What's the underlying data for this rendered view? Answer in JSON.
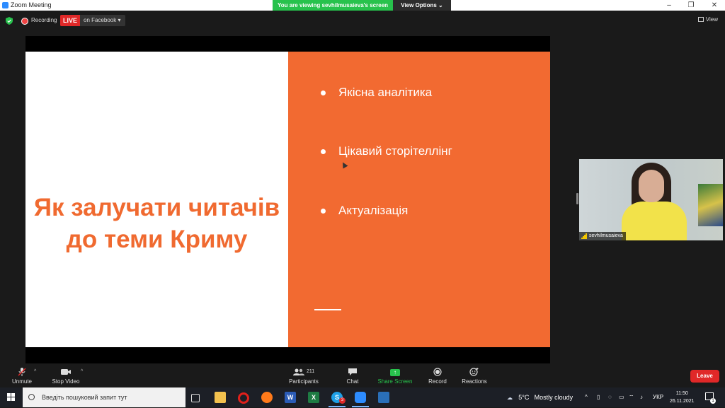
{
  "window": {
    "title": "Zoom Meeting",
    "sharing_banner": "You are viewing sevhilmusaieva's screen",
    "view_options_label": "View Options",
    "minimize_glyph": "–",
    "restore_glyph": "❐",
    "close_glyph": "✕"
  },
  "meeting_bar": {
    "recording_label": "Recording",
    "live_label": "LIVE",
    "live_target": "on Facebook",
    "view_label": "View"
  },
  "slide": {
    "title": "Як залучати читачів до теми Криму",
    "bullets": [
      "Якісна аналітика",
      "Цікавий сторітеллінг",
      "Актуалізація"
    ],
    "left_bg": "#ffffff",
    "right_bg": "#f26a31",
    "title_color": "#f06a30"
  },
  "participant": {
    "name": "sevhilmusaieva"
  },
  "toolbar": {
    "unmute": "Unmute",
    "stop_video": "Stop Video",
    "participants": "Participants",
    "participants_count": "211",
    "chat": "Chat",
    "share_screen": "Share Screen",
    "record": "Record",
    "reactions": "Reactions",
    "leave": "Leave"
  },
  "taskbar": {
    "search_placeholder": "Введіть пошуковий запит тут",
    "apps": [
      "task-view",
      "file-explorer",
      "opera",
      "firefox",
      "word",
      "excel",
      "skype",
      "zoom",
      "photos"
    ],
    "skype_badge": "3",
    "weather_temp": "5°C",
    "weather_text": "Mostly cloudy",
    "language": "УКР",
    "time": "11:50",
    "date": "26.11.2021",
    "notification_count": "1"
  },
  "colors": {
    "zoom_green": "#27c24c",
    "live_red": "#e02828",
    "slide_orange": "#f26a31"
  }
}
